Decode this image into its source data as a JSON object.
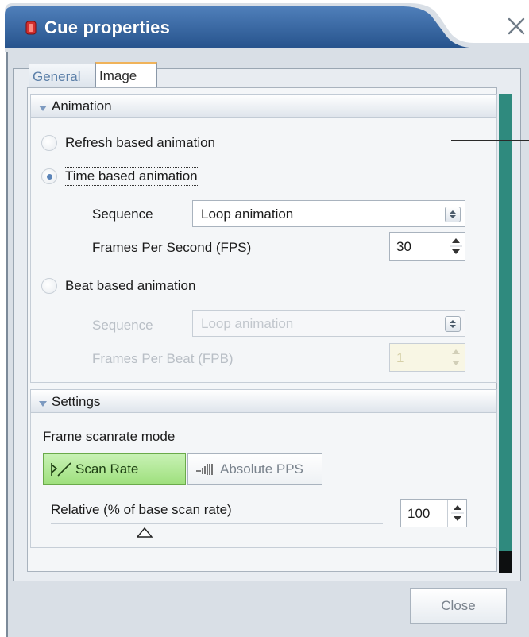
{
  "window": {
    "title": "Cue properties",
    "close_glyph": "×"
  },
  "tabs": [
    {
      "label": "General",
      "active": false
    },
    {
      "label": "Image",
      "active": true
    }
  ],
  "animation": {
    "header": "Animation",
    "refresh_label": "Refresh based animation",
    "time_label": "Time based animation",
    "time_sequence_label": "Sequence",
    "time_sequence_value": "Loop animation",
    "fps_label": "Frames Per Second (FPS)",
    "fps_value": "30",
    "beat_label": "Beat based animation",
    "beat_sequence_label": "Sequence",
    "beat_sequence_value": "Loop animation",
    "fpb_label": "Frames Per Beat (FPB)",
    "fpb_value": "1",
    "selected": "time"
  },
  "settings": {
    "header": "Settings",
    "scanrate_mode_label": "Frame scanrate mode",
    "scan_rate_label": "Scan Rate",
    "absolute_pps_label": "Absolute PPS",
    "active_mode": "scan_rate",
    "relative_label": "Relative (% of base scan rate)",
    "relative_value": "100"
  },
  "footer": {
    "close_label": "Close"
  },
  "colors": {
    "titlebar": "#2c5d9a",
    "accent_tab": "#f0b35a",
    "scan_rate_on": "#9fe07e",
    "scrollbar": "#2f8a7e"
  },
  "icons": [
    "app-icon",
    "close-icon",
    "chevron-down-icon",
    "select-arrows-icon",
    "spin-arrows-icon",
    "scan-rate-icon",
    "absolute-pps-icon",
    "slider-thumb-icon"
  ]
}
